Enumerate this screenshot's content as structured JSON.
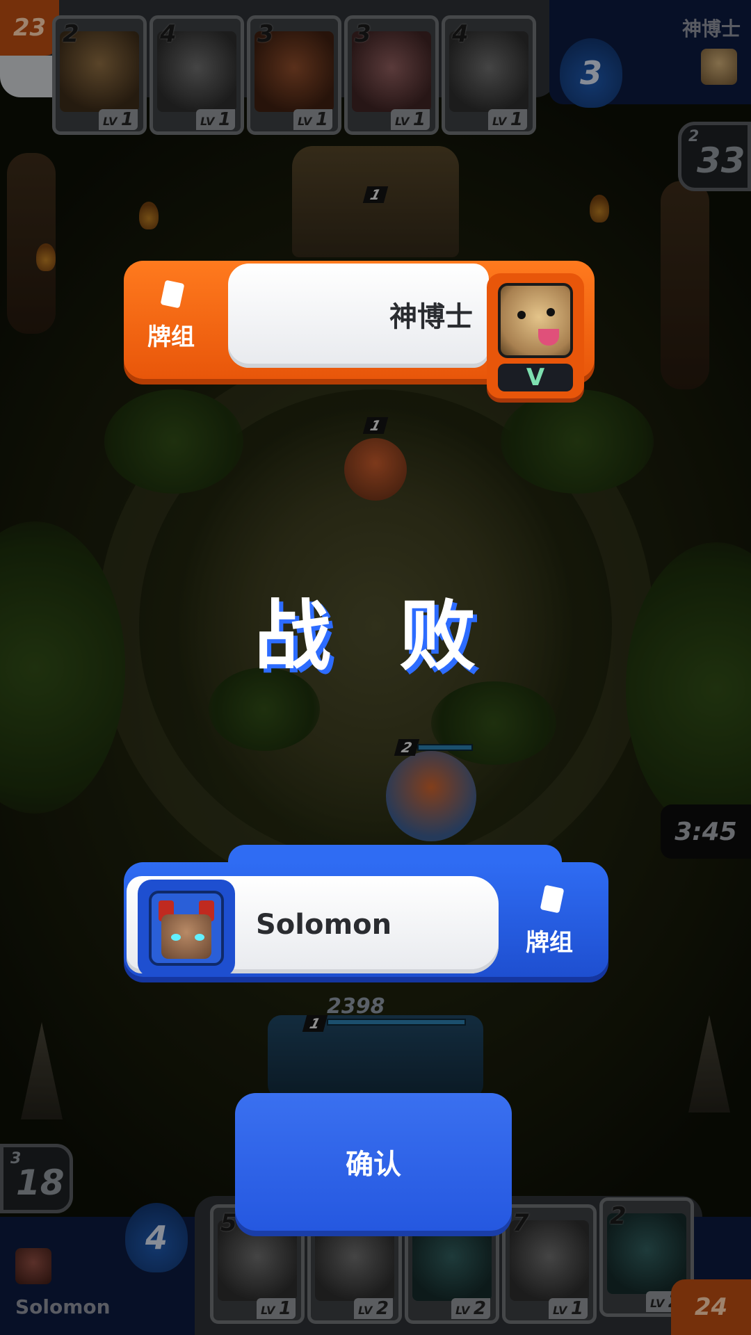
{
  "top_bar": {
    "score": "23",
    "opponent_name": "神博士",
    "elixir": "3",
    "cards": [
      {
        "cost": "2",
        "lv_label": "LV",
        "lv": "1",
        "art": "hooded-archer"
      },
      {
        "cost": "4",
        "lv_label": "LV",
        "lv": "1",
        "art": "armored-knight"
      },
      {
        "cost": "3",
        "lv_label": "LV",
        "lv": "1",
        "art": "red-crab-beast"
      },
      {
        "cost": "3",
        "lv_label": "LV",
        "lv": "1",
        "art": "pig-bandit"
      },
      {
        "cost": "4",
        "lv_label": "LV",
        "lv": "1",
        "art": "armored-knight"
      }
    ],
    "timer_small": "2",
    "timer_big": "33"
  },
  "arena": {
    "enemy_unit_level": "1",
    "enemy_tower_level": "1",
    "player_unit_level": "2",
    "player_tower_level": "1",
    "player_tower_score": "2398"
  },
  "opponent_banner": {
    "deck_label": "牌组",
    "name": "神博士",
    "avatar": "hyena-icon",
    "badge": "V"
  },
  "result": {
    "title": "战 败"
  },
  "match_timer": "3:45",
  "player_banner": {
    "deck_label": "牌组",
    "name": "Solomon",
    "avatar": "tiki-mask-icon"
  },
  "confirm_button": "确认",
  "bottom_bar": {
    "player_name": "Solomon",
    "score": "24",
    "elixir": "4",
    "timer_small": "3",
    "timer_big": "18",
    "cards": [
      {
        "cost": "5",
        "lv_label": "LV",
        "lv": "1",
        "art": "stone-golem"
      },
      {
        "cost": "",
        "lv_label": "LV",
        "lv": "2",
        "art": "robot-tank"
      },
      {
        "cost": "",
        "lv_label": "LV",
        "lv": "2",
        "art": "teal-mech"
      },
      {
        "cost": "7",
        "lv_label": "LV",
        "lv": "1",
        "art": "bomb-launcher"
      },
      {
        "cost": "2",
        "lv_label": "LV",
        "lv": "2",
        "art": "soldiers"
      }
    ]
  },
  "colors": {
    "opponent_accent": "#ff7a1e",
    "player_accent": "#2f6cf3",
    "defeat_shadow": "#2d6cff"
  }
}
